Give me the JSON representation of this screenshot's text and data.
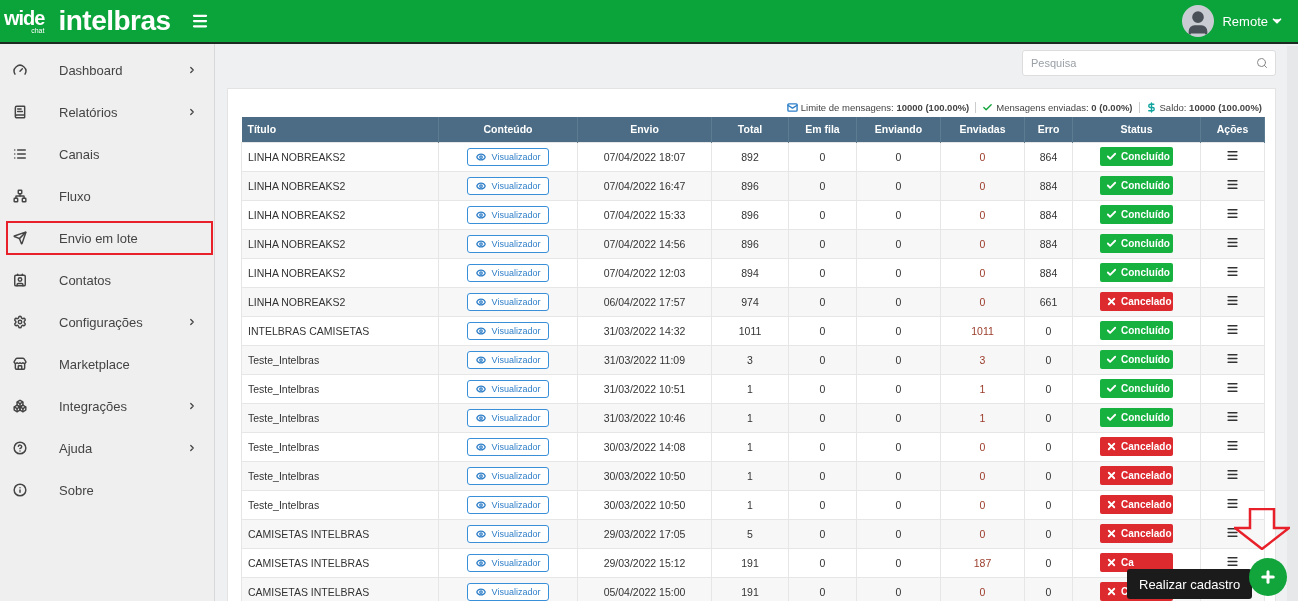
{
  "header": {
    "logo_small": "wide",
    "logo_small_sub": "chat",
    "logo_brand": "intelbras",
    "user": "Remote"
  },
  "sidebar": {
    "items": [
      {
        "label": "Dashboard",
        "has_submenu": true,
        "highlighted": false
      },
      {
        "label": "Relatórios",
        "has_submenu": true,
        "highlighted": false
      },
      {
        "label": "Canais",
        "has_submenu": false,
        "highlighted": false
      },
      {
        "label": "Fluxo",
        "has_submenu": false,
        "highlighted": false
      },
      {
        "label": "Envio em lote",
        "has_submenu": false,
        "highlighted": true
      },
      {
        "label": "Contatos",
        "has_submenu": false,
        "highlighted": false
      },
      {
        "label": "Configurações",
        "has_submenu": true,
        "highlighted": false
      },
      {
        "label": "Marketplace",
        "has_submenu": false,
        "highlighted": false
      },
      {
        "label": "Integrações",
        "has_submenu": true,
        "highlighted": false
      },
      {
        "label": "Ajuda",
        "has_submenu": true,
        "highlighted": false
      },
      {
        "label": "Sobre",
        "has_submenu": false,
        "highlighted": false
      }
    ]
  },
  "search": {
    "placeholder": "Pesquisa"
  },
  "stats": [
    {
      "kind": "mail",
      "label": "Limite de mensagens:",
      "value": "10000 (100.00%)"
    },
    {
      "kind": "check",
      "label": "Mensagens enviadas:",
      "value": "0 (0.00%)"
    },
    {
      "kind": "money",
      "label": "Saldo:",
      "value": "10000 (100.00%)"
    }
  ],
  "table": {
    "columns": [
      "Título",
      "Conteúdo",
      "Envio",
      "Total",
      "Em fila",
      "Enviando",
      "Enviadas",
      "Erro",
      "Status",
      "Ações"
    ],
    "rows": [
      {
        "title": "LINHA NOBREAKS2",
        "content": "Visualizador",
        "date": "07/04/2022 18:07",
        "total": "892",
        "queued": "0",
        "sending": "0",
        "sent": "0",
        "error": "864",
        "status": {
          "kind": "done",
          "label": "Concluído"
        }
      },
      {
        "title": "LINHA NOBREAKS2",
        "content": "Visualizador",
        "date": "07/04/2022 16:47",
        "total": "896",
        "queued": "0",
        "sending": "0",
        "sent": "0",
        "error": "884",
        "status": {
          "kind": "done",
          "label": "Concluído"
        }
      },
      {
        "title": "LINHA NOBREAKS2",
        "content": "Visualizador",
        "date": "07/04/2022 15:33",
        "total": "896",
        "queued": "0",
        "sending": "0",
        "sent": "0",
        "error": "884",
        "status": {
          "kind": "done",
          "label": "Concluído"
        }
      },
      {
        "title": "LINHA NOBREAKS2",
        "content": "Visualizador",
        "date": "07/04/2022 14:56",
        "total": "896",
        "queued": "0",
        "sending": "0",
        "sent": "0",
        "error": "884",
        "status": {
          "kind": "done",
          "label": "Concluído"
        }
      },
      {
        "title": "LINHA NOBREAKS2",
        "content": "Visualizador",
        "date": "07/04/2022 12:03",
        "total": "894",
        "queued": "0",
        "sending": "0",
        "sent": "0",
        "error": "884",
        "status": {
          "kind": "done",
          "label": "Concluído"
        }
      },
      {
        "title": "LINHA NOBREAKS2",
        "content": "Visualizador",
        "date": "06/04/2022 17:57",
        "total": "974",
        "queued": "0",
        "sending": "0",
        "sent": "0",
        "error": "661",
        "status": {
          "kind": "cancelled",
          "label": "Cancelado"
        }
      },
      {
        "title": "INTELBRAS CAMISETAS",
        "content": "Visualizador",
        "date": "31/03/2022 14:32",
        "total": "1011",
        "queued": "0",
        "sending": "0",
        "sent": "1011",
        "error": "0",
        "status": {
          "kind": "done",
          "label": "Concluído"
        }
      },
      {
        "title": "Teste_Intelbras",
        "content": "Visualizador",
        "date": "31/03/2022 11:09",
        "total": "3",
        "queued": "0",
        "sending": "0",
        "sent": "3",
        "error": "0",
        "status": {
          "kind": "done",
          "label": "Concluído"
        }
      },
      {
        "title": "Teste_Intelbras",
        "content": "Visualizador",
        "date": "31/03/2022 10:51",
        "total": "1",
        "queued": "0",
        "sending": "0",
        "sent": "1",
        "error": "0",
        "status": {
          "kind": "done",
          "label": "Concluído"
        }
      },
      {
        "title": "Teste_Intelbras",
        "content": "Visualizador",
        "date": "31/03/2022 10:46",
        "total": "1",
        "queued": "0",
        "sending": "0",
        "sent": "1",
        "error": "0",
        "status": {
          "kind": "done",
          "label": "Concluído"
        }
      },
      {
        "title": "Teste_Intelbras",
        "content": "Visualizador",
        "date": "30/03/2022 14:08",
        "total": "1",
        "queued": "0",
        "sending": "0",
        "sent": "0",
        "error": "0",
        "status": {
          "kind": "cancelled",
          "label": "Cancelado"
        }
      },
      {
        "title": "Teste_Intelbras",
        "content": "Visualizador",
        "date": "30/03/2022 10:50",
        "total": "1",
        "queued": "0",
        "sending": "0",
        "sent": "0",
        "error": "0",
        "status": {
          "kind": "cancelled",
          "label": "Cancelado"
        }
      },
      {
        "title": "Teste_Intelbras",
        "content": "Visualizador",
        "date": "30/03/2022 10:50",
        "total": "1",
        "queued": "0",
        "sending": "0",
        "sent": "0",
        "error": "0",
        "status": {
          "kind": "cancelled",
          "label": "Cancelado"
        }
      },
      {
        "title": "CAMISETAS INTELBRAS",
        "content": "Visualizador",
        "date": "29/03/2022 17:05",
        "total": "5",
        "queued": "0",
        "sending": "0",
        "sent": "0",
        "error": "0",
        "status": {
          "kind": "cancelled",
          "label": "Cancelado"
        }
      },
      {
        "title": "CAMISETAS INTELBRAS",
        "content": "Visualizador",
        "date": "29/03/2022 15:12",
        "total": "191",
        "queued": "0",
        "sending": "0",
        "sent": "187",
        "error": "0",
        "status": {
          "kind": "cancelled",
          "label": "Ca"
        }
      },
      {
        "title": "CAMISETAS INTELBRAS",
        "content": "Visualizador",
        "date": "05/04/2022 15:00",
        "total": "191",
        "queued": "0",
        "sending": "0",
        "sent": "0",
        "error": "0",
        "status": {
          "kind": "cancelled",
          "label": "C"
        }
      }
    ]
  },
  "fab": {
    "tooltip": "Realizar cadastro"
  }
}
